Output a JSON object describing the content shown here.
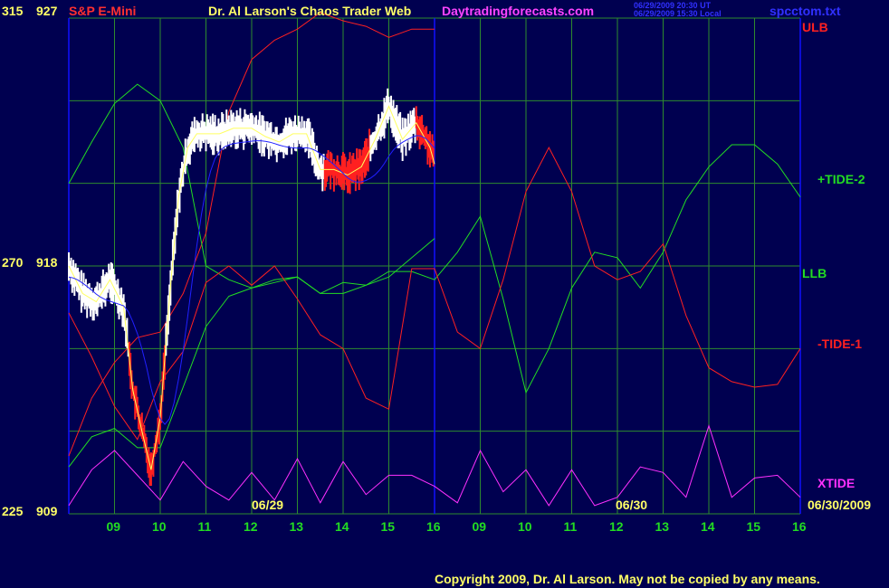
{
  "header": {
    "instrument": "S&P E-Mini",
    "title": "Dr. Al Larson's Chaos Trader Web",
    "site": "Daytradingforecasts.com",
    "timestamp_ut": "06/29/2009 20:30 UT",
    "timestamp_local": "06/29/2009 15:30 Local",
    "filename": "spcctom.txt"
  },
  "footer": {
    "copyright": "Copyright 2009, Dr. Al Larson. May not be copied by any means."
  },
  "colors": {
    "background": "#000050",
    "grid": "#2e8b2e",
    "axis": "#1010ff",
    "price_bar": "#ffffff",
    "price_down": "#ff2020",
    "price_mid": "#ffff60",
    "ulb": "#ff2020",
    "tide2": "#22dd22",
    "llb": "#22dd22",
    "tide1": "#ff2020",
    "xtide": "#ff30ff",
    "average": "#2020ff",
    "title_yellow": "#ffff66",
    "magenta": "#ff44ff"
  },
  "chart_data": {
    "type": "line",
    "title": "S&P E-Mini",
    "y_axis_left": {
      "ticks": [
        {
          "deg": "315",
          "price": "927"
        },
        {
          "deg": "270",
          "price": "918"
        },
        {
          "deg": "225",
          "price": "909"
        }
      ],
      "range": [
        909,
        927
      ]
    },
    "x_axis": {
      "hour_labels": [
        "09",
        "10",
        "11",
        "12",
        "13",
        "14",
        "15",
        "16",
        "09",
        "10",
        "11",
        "12",
        "13",
        "14",
        "15",
        "16"
      ],
      "date_labels": [
        "06/29",
        "06/30"
      ],
      "end_date": "06/30/2009"
    },
    "series_labels": [
      {
        "name": "ULB",
        "color": "#ff2020"
      },
      {
        "name": "+TIDE-2",
        "color": "#22dd22"
      },
      {
        "name": "LLB",
        "color": "#22dd22"
      },
      {
        "name": "-TIDE-1",
        "color": "#ff2020"
      },
      {
        "name": "XTIDE",
        "color": "#ff30ff"
      }
    ],
    "series": [
      {
        "name": "ULB",
        "x": [
          0,
          0.5,
          1,
          1.5,
          2,
          2.5,
          3,
          3.5,
          4,
          4.5,
          5,
          5.5,
          6,
          6.5,
          7,
          7.5,
          8
        ],
        "y": [
          911.1,
          913.2,
          914.5,
          915.4,
          915.6,
          917.0,
          919.2,
          923.6,
          925.5,
          926.2,
          926.6,
          927.2,
          926.9,
          926.7,
          926.3,
          926.6,
          926.6
        ]
      },
      {
        "name": "+TIDE-2",
        "x": [
          0,
          0.5,
          1,
          1.5,
          2,
          2.5,
          3,
          3.5,
          4,
          4.5,
          5,
          5.5,
          6,
          6.5,
          7,
          7.5,
          8,
          8.5,
          9,
          9.5,
          10,
          10.5,
          11,
          11.5,
          12,
          12.5,
          13,
          13.5,
          14,
          14.5,
          15,
          15.5,
          16
        ],
        "y": [
          921.0,
          922.5,
          923.9,
          924.6,
          924.0,
          922.3,
          918.0,
          917.5,
          917.2,
          917.5,
          917.6,
          917.0,
          917.0,
          917.3,
          917.8,
          917.8,
          917.5,
          918.5,
          919.8,
          916.8,
          913.4,
          915.0,
          917.2,
          918.5,
          918.3,
          917.2,
          918.5,
          920.4,
          921.6,
          922.4,
          922.4,
          921.7,
          920.5
        ]
      },
      {
        "name": "LLB",
        "x": [
          0,
          0.5,
          1,
          1.5,
          2,
          2.5,
          3,
          3.5,
          4,
          4.5,
          5,
          5.5,
          6,
          6.5,
          7,
          7.5,
          8
        ],
        "y": [
          910.7,
          911.8,
          912.1,
          911.4,
          911.4,
          913.6,
          915.8,
          916.9,
          917.2,
          917.4,
          917.6,
          917.0,
          917.4,
          917.3,
          917.6,
          918.3,
          919.0
        ]
      },
      {
        "name": "-TIDE-1",
        "x": [
          0,
          0.5,
          1,
          1.5,
          2,
          2.5,
          3,
          3.5,
          4,
          4.5,
          5,
          5.5,
          6,
          6.5,
          7,
          7.5,
          8,
          8.5,
          9,
          9.5,
          10,
          10.5,
          11,
          11.5,
          12,
          12.5,
          13,
          13.5,
          14,
          14.5,
          15,
          15.5,
          16
        ],
        "y": [
          916.3,
          914.7,
          912.9,
          911.7,
          913.8,
          914.9,
          917.4,
          918.0,
          917.3,
          918.0,
          916.8,
          915.5,
          915.0,
          913.2,
          912.8,
          917.9,
          917.9,
          915.6,
          915.0,
          917.5,
          920.7,
          922.3,
          920.7,
          918.0,
          917.5,
          917.8,
          918.8,
          916.2,
          914.3,
          913.8,
          913.6,
          913.7,
          915.0
        ]
      },
      {
        "name": "XTIDE",
        "x": [
          0,
          0.5,
          1,
          1.5,
          2,
          2.5,
          3,
          3.5,
          4,
          4.5,
          5,
          5.5,
          6,
          6.5,
          7,
          7.5,
          8,
          8.5,
          9,
          9.5,
          10,
          10.5,
          11,
          11.5,
          12,
          12.5,
          13,
          13.5,
          14,
          14.5,
          15,
          15.5,
          16
        ],
        "y": [
          909.3,
          910.6,
          911.3,
          910.4,
          909.5,
          910.9,
          910.0,
          909.5,
          910.5,
          909.5,
          911.0,
          909.4,
          910.9,
          909.7,
          910.4,
          910.4,
          910.0,
          909.4,
          911.3,
          909.8,
          910.6,
          909.3,
          910.6,
          909.3,
          909.6,
          910.7,
          910.5,
          909.6,
          912.2,
          909.6,
          910.3,
          910.4,
          909.6
        ]
      },
      {
        "name": "price",
        "x": [
          0,
          0.3,
          0.6,
          0.9,
          1.2,
          1.4,
          1.6,
          1.8,
          2.0,
          2.2,
          2.4,
          2.6,
          2.8,
          3.0,
          3.3,
          3.6,
          4.0,
          4.3,
          4.6,
          4.9,
          5.2,
          5.5,
          5.8,
          6.1,
          6.4,
          6.7,
          7.0,
          7.3,
          7.6,
          7.9,
          8.0
        ],
        "y": [
          918.0,
          917.0,
          916.7,
          917.5,
          916.5,
          913.5,
          912.0,
          910.6,
          912.5,
          916.8,
          920.5,
          922.3,
          922.8,
          922.8,
          922.8,
          923.0,
          923.0,
          922.7,
          922.5,
          922.8,
          922.8,
          921.5,
          921.5,
          921.3,
          921.6,
          922.6,
          923.8,
          922.6,
          923.2,
          922.3,
          921.7
        ]
      }
    ]
  }
}
